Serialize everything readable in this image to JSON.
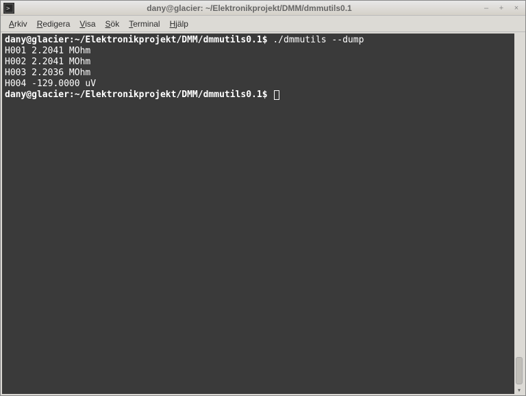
{
  "window": {
    "title": "dany@glacier: ~/Elektronikprojekt/DMM/dmmutils0.1"
  },
  "menubar": {
    "items": [
      {
        "label": "Arkiv",
        "accel": "A"
      },
      {
        "label": "Redigera",
        "accel": "R"
      },
      {
        "label": "Visa",
        "accel": "V"
      },
      {
        "label": "Sök",
        "accel": "S"
      },
      {
        "label": "Terminal",
        "accel": "T"
      },
      {
        "label": "Hjälp",
        "accel": "H"
      }
    ]
  },
  "terminal": {
    "prompt_user": "dany@glacier",
    "prompt_path": "~/Elektronikprojekt/DMM/dmmutils0.1",
    "prompt_symbol": "$",
    "command": "./dmmutils --dump",
    "output": [
      "H001 2.2041 MOhm",
      "H002 2.2041 MOhm",
      "H003 2.2036 MOhm",
      "H004 -129.0000 uV"
    ]
  },
  "titlebar_buttons": {
    "minimize": "–",
    "maximize": "+",
    "close": "×"
  }
}
